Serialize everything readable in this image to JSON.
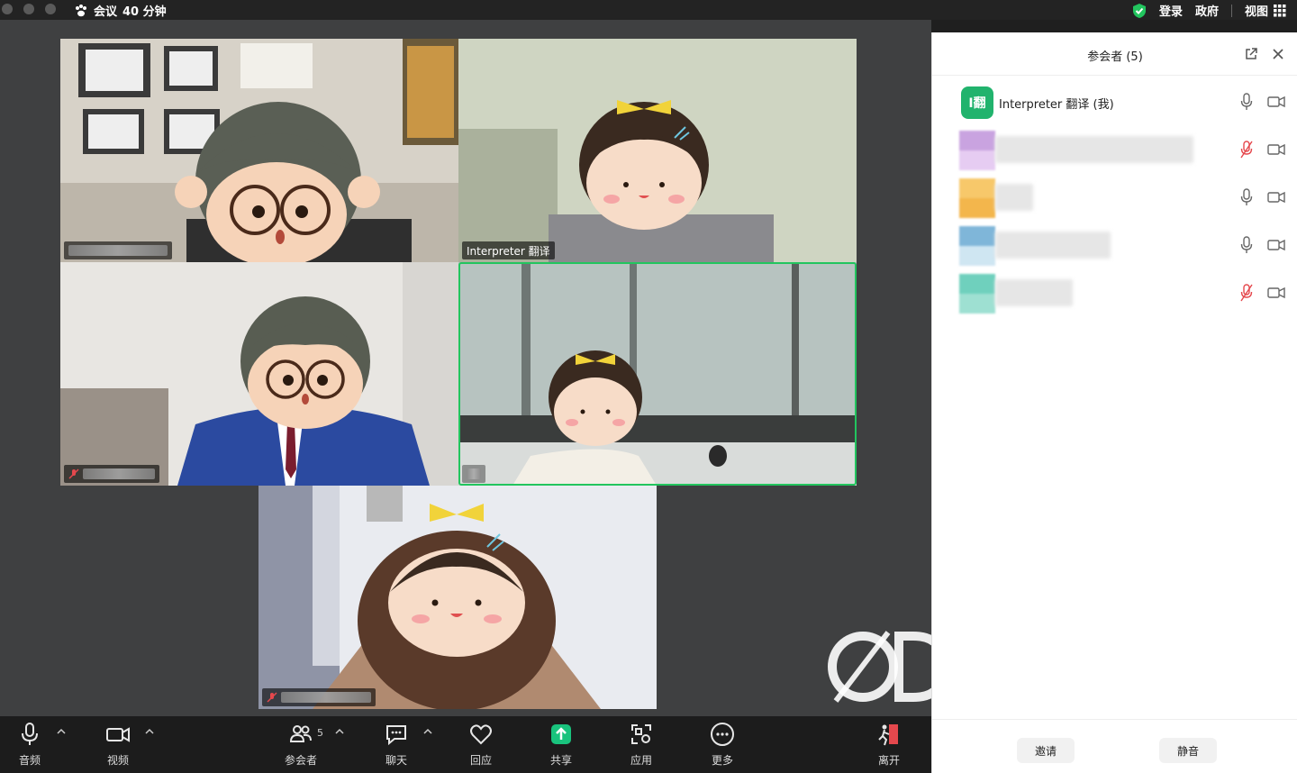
{
  "titlebar": {
    "meeting_title": "会议",
    "duration": "40 分钟",
    "login": "登录",
    "gov": "政府",
    "view": "视图"
  },
  "tiles": [
    {
      "name": "",
      "muted": false
    },
    {
      "name": "Interpreter 翻译",
      "muted": false
    },
    {
      "name": "",
      "muted": true
    },
    {
      "name": "",
      "muted": false,
      "active": true
    },
    {
      "name": "",
      "muted": true
    }
  ],
  "toolbar": {
    "audio": "音频",
    "video": "视频",
    "participants": "参会者",
    "participants_count": "5",
    "chat": "聊天",
    "react": "回应",
    "share": "共享",
    "apps": "应用",
    "more": "更多",
    "leave": "离开"
  },
  "panel": {
    "title": "参会者 (5)",
    "self": {
      "avatar": "I翻",
      "name": "Interpreter 翻译 (我)",
      "muted": false
    },
    "others": [
      {
        "muted": true,
        "colors": [
          "#c9a3e0",
          "#e6ccf2"
        ]
      },
      {
        "muted": false,
        "colors": [
          "#f7c86a",
          "#f3b64c"
        ]
      },
      {
        "muted": false,
        "colors": [
          "#7fb6d9",
          "#cfe6f2"
        ]
      },
      {
        "muted": true,
        "colors": [
          "#6fd0bd",
          "#9ee0d2"
        ]
      }
    ],
    "invite": "邀请",
    "mute_all": "静音"
  },
  "colors": {
    "accent_green": "#22c55e",
    "share_green": "#19c37d",
    "muted_red": "#e5484d"
  }
}
